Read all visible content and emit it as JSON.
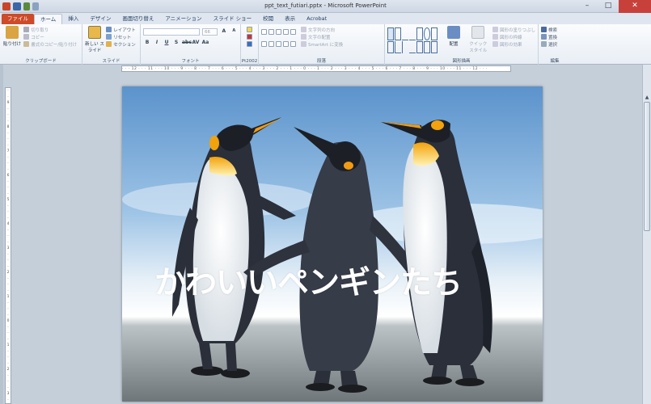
{
  "window": {
    "title": "ppt_text_futiari.pptx - Microsoft PowerPoint"
  },
  "tabs": [
    {
      "label": "ファイル"
    },
    {
      "label": "ホーム"
    },
    {
      "label": "挿入"
    },
    {
      "label": "デザイン"
    },
    {
      "label": "画面切り替え"
    },
    {
      "label": "アニメーション"
    },
    {
      "label": "スライド ショー"
    },
    {
      "label": "校閲"
    },
    {
      "label": "表示"
    },
    {
      "label": "Acrobat"
    }
  ],
  "ribbon": {
    "clipboard": {
      "paste": "貼り付け",
      "cut": "切り取り",
      "copy": "コピー",
      "format_painter": "書式のコピー/貼り付け",
      "label": "クリップボード"
    },
    "slides": {
      "new_slide": "新しい スライド",
      "layout": "レイアウト",
      "reset": "リセット",
      "section": "セクション",
      "label": "スライド"
    },
    "font": {
      "size": "66",
      "label": "フォント"
    },
    "pt2002": {
      "label": "Pt2002"
    },
    "paragraph": {
      "text_direction": "文字列の方向",
      "align_text": "文字の配置",
      "smartart": "SmartArt に変換",
      "label": "段落"
    },
    "drawing": {
      "arrange": "配置",
      "quick_styles": "クイック スタイル",
      "shape_fill": "図形の塗りつぶし",
      "shape_outline": "図形の枠線",
      "shape_effects": "図形の効果",
      "label": "図形描画"
    },
    "editing": {
      "find": "検索",
      "replace": "置換",
      "select": "選択",
      "label": "編集"
    }
  },
  "ruler": {
    "h": "· · · 12 · · · 11 · · · 10 · · · 9 · · · 8 · · · 7 · · · 6 · · · 5 · · · 4 · · · 3 · · · 2 · · · 1 · · · 0 · · · 1 · · · 2 · · · 3 · · · 4 · · · 5 · · · 6 · · · 7 · · · 8 · · · 9 · · · 10 · · · 11 · · · 12 · · ·"
  },
  "slide": {
    "text": "かわいいペンギンたち"
  },
  "colors": {
    "file_tab": "#cd4b29",
    "ribbon_bg": "#f5f7fa",
    "workspace": "#c5cfda"
  }
}
